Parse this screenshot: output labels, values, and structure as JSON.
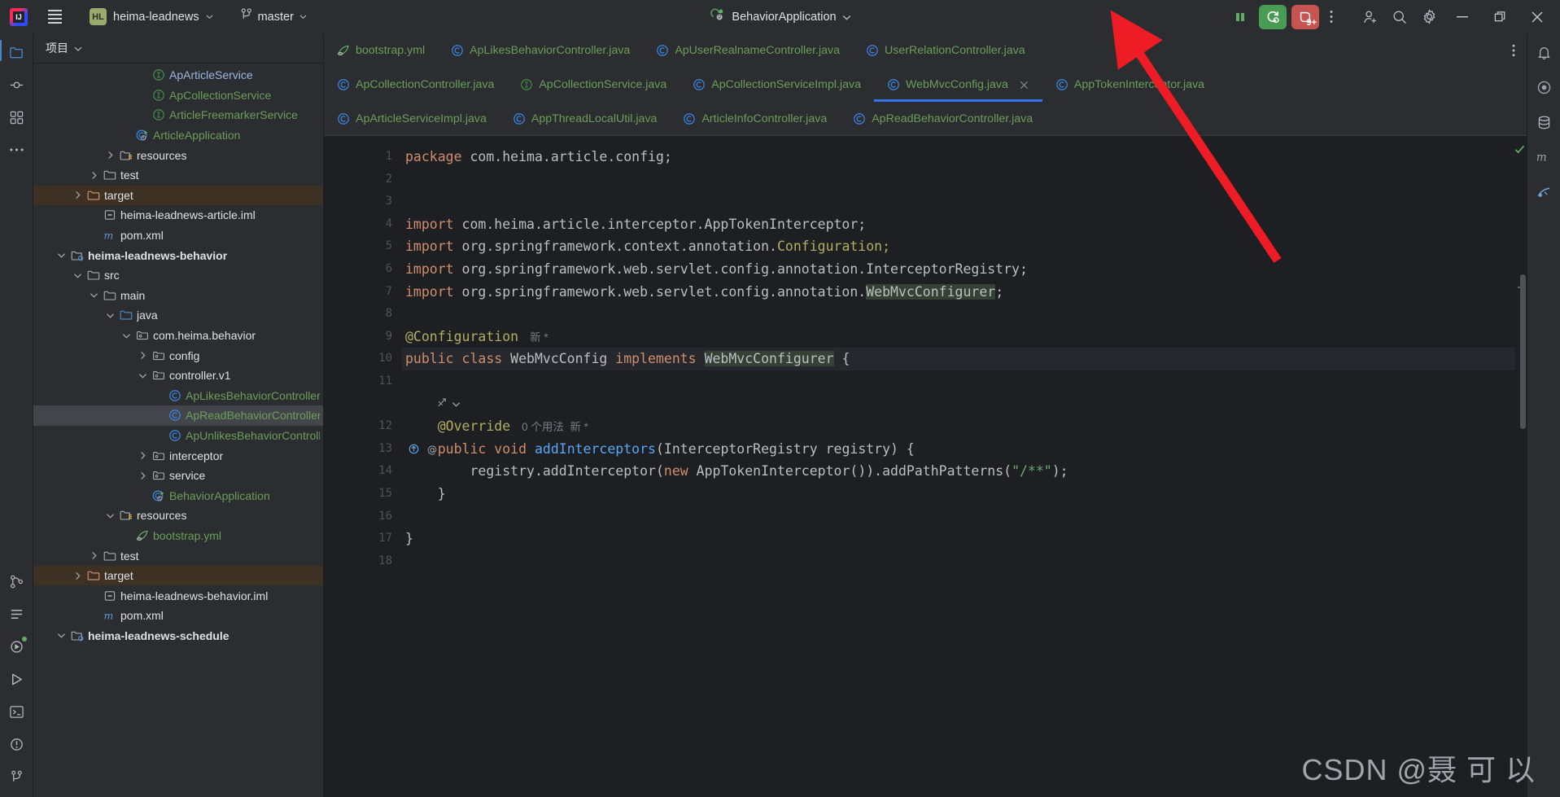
{
  "titlebar": {
    "logo_name": "intellij-idea-logo",
    "menu_label": "main-menu",
    "project_badge": "HL",
    "project_name": "heima-leadnews",
    "branch_name": "master",
    "run_config_name": "BehaviorApplication",
    "buttons": {
      "stop": "stop-icon",
      "rerun": "rerun-icon",
      "debug": "debug-icon",
      "debug_badge": "9+",
      "more": "more-options-icon",
      "share": "add-user-icon",
      "search": "search-icon",
      "settings": "settings-icon",
      "minimize": "minimize-icon",
      "maximize": "maximize-icon",
      "close": "close-icon"
    }
  },
  "activity_bar": {
    "items": [
      {
        "name": "project-tool-icon",
        "label": "Project",
        "active": true
      },
      {
        "name": "commit-tool-icon",
        "label": "Commit"
      },
      {
        "name": "structure-tool-icon",
        "label": "Structure"
      },
      {
        "name": "more-tool-icon",
        "label": "More"
      },
      {
        "name": "version-control-icon",
        "label": "Version Control"
      },
      {
        "name": "todo-icon",
        "label": "TODO"
      },
      {
        "name": "services-icon",
        "label": "Services"
      },
      {
        "name": "run-icon",
        "label": "Run"
      },
      {
        "name": "terminal-icon",
        "label": "Terminal"
      },
      {
        "name": "problems-icon",
        "label": "Problems"
      },
      {
        "name": "git-branch-icon",
        "label": "Git"
      }
    ]
  },
  "right_bar": {
    "items": [
      {
        "name": "notifications-icon",
        "label": "Notifications"
      },
      {
        "name": "ai-assistant-icon",
        "label": "AI Assistant"
      },
      {
        "name": "database-icon",
        "label": "Database"
      },
      {
        "name": "maven-icon",
        "label": "Maven"
      },
      {
        "name": "gradle-icon",
        "label": "Gradle"
      }
    ]
  },
  "project_panel": {
    "title": "项目",
    "tree": [
      {
        "indent": 6,
        "arrow": "none",
        "icon": "interface-icon",
        "label": "ApArticleService",
        "color": "blue"
      },
      {
        "indent": 6,
        "arrow": "none",
        "icon": "interface-icon",
        "label": "ApCollectionService",
        "color": "green"
      },
      {
        "indent": 6,
        "arrow": "none",
        "icon": "interface-icon",
        "label": "ArticleFreemarkerService",
        "color": "green"
      },
      {
        "indent": 5,
        "arrow": "none",
        "icon": "spring-class-icon",
        "label": "ArticleApplication",
        "color": "green"
      },
      {
        "indent": 4,
        "arrow": "right",
        "icon": "resources-folder-icon",
        "label": "resources",
        "color": "white"
      },
      {
        "indent": 3,
        "arrow": "right",
        "icon": "folder-icon",
        "label": "test",
        "color": "white"
      },
      {
        "indent": 2,
        "arrow": "right",
        "icon": "target-folder-icon",
        "label": "target",
        "color": "white",
        "row_state": "orange"
      },
      {
        "indent": 3,
        "arrow": "none",
        "icon": "iml-file-icon",
        "label": "heima-leadnews-article.iml",
        "color": "white"
      },
      {
        "indent": 3,
        "arrow": "none",
        "icon": "maven-pom-icon",
        "label": "pom.xml",
        "color": "white"
      },
      {
        "indent": 1,
        "arrow": "down",
        "icon": "module-icon",
        "label": "heima-leadnews-behavior",
        "color": "white",
        "bold": true
      },
      {
        "indent": 2,
        "arrow": "down",
        "icon": "folder-icon",
        "label": "src",
        "color": "white"
      },
      {
        "indent": 3,
        "arrow": "down",
        "icon": "folder-icon",
        "label": "main",
        "color": "white"
      },
      {
        "indent": 4,
        "arrow": "down",
        "icon": "source-folder-icon",
        "label": "java",
        "color": "white"
      },
      {
        "indent": 5,
        "arrow": "down",
        "icon": "package-icon",
        "label": "com.heima.behavior",
        "color": "white"
      },
      {
        "indent": 6,
        "arrow": "right",
        "icon": "package-icon",
        "label": "config",
        "color": "white"
      },
      {
        "indent": 6,
        "arrow": "down",
        "icon": "package-icon",
        "label": "controller.v1",
        "color": "white"
      },
      {
        "indent": 7,
        "arrow": "none",
        "icon": "class-icon",
        "label": "ApLikesBehaviorController",
        "color": "green"
      },
      {
        "indent": 7,
        "arrow": "none",
        "icon": "class-icon",
        "label": "ApReadBehaviorController",
        "color": "green",
        "row_state": "selected"
      },
      {
        "indent": 7,
        "arrow": "none",
        "icon": "class-icon",
        "label": "ApUnlikesBehaviorController",
        "color": "green"
      },
      {
        "indent": 6,
        "arrow": "right",
        "icon": "package-icon",
        "label": "interceptor",
        "color": "white"
      },
      {
        "indent": 6,
        "arrow": "right",
        "icon": "package-icon",
        "label": "service",
        "color": "white"
      },
      {
        "indent": 6,
        "arrow": "none",
        "icon": "spring-class-icon",
        "label": "BehaviorApplication",
        "color": "green"
      },
      {
        "indent": 4,
        "arrow": "down",
        "icon": "resources-folder-icon",
        "label": "resources",
        "color": "white"
      },
      {
        "indent": 5,
        "arrow": "none",
        "icon": "yaml-icon",
        "label": "bootstrap.yml",
        "color": "green"
      },
      {
        "indent": 3,
        "arrow": "right",
        "icon": "folder-icon",
        "label": "test",
        "color": "white"
      },
      {
        "indent": 2,
        "arrow": "right",
        "icon": "target-folder-icon",
        "label": "target",
        "color": "white",
        "row_state": "orange"
      },
      {
        "indent": 3,
        "arrow": "none",
        "icon": "iml-file-icon",
        "label": "heima-leadnews-behavior.iml",
        "color": "white"
      },
      {
        "indent": 3,
        "arrow": "none",
        "icon": "maven-pom-icon",
        "label": "pom.xml",
        "color": "white"
      },
      {
        "indent": 1,
        "arrow": "down",
        "icon": "module-icon",
        "label": "heima-leadnews-schedule",
        "color": "white",
        "bold": true
      }
    ]
  },
  "editor": {
    "tab_rows": [
      [
        {
          "label": "bootstrap.yml",
          "icon": "yaml-icon"
        },
        {
          "label": "ApLikesBehaviorController.java",
          "icon": "class-icon"
        },
        {
          "label": "ApUserRealnameController.java",
          "icon": "class-icon"
        },
        {
          "label": "UserRelationController.java",
          "icon": "class-icon"
        }
      ],
      [
        {
          "label": "ApCollectionController.java",
          "icon": "class-icon"
        },
        {
          "label": "ApCollectionService.java",
          "icon": "interface-icon"
        },
        {
          "label": "ApCollectionServiceImpl.java",
          "icon": "class-icon"
        },
        {
          "label": "WebMvcConfig.java",
          "icon": "class-icon",
          "active": true,
          "closable": true
        },
        {
          "label": "AppTokenInterceptor.java",
          "icon": "class-icon"
        }
      ],
      [
        {
          "label": "ApArticleServiceImpl.java",
          "icon": "class-icon"
        },
        {
          "label": "AppThreadLocalUtil.java",
          "icon": "class-icon"
        },
        {
          "label": "ArticleInfoController.java",
          "icon": "class-icon"
        },
        {
          "label": "ApReadBehaviorController.java",
          "icon": "class-icon"
        }
      ]
    ],
    "tab_overflow_icon": "more-tabs-icon",
    "line_numbers": [
      "1",
      "2",
      "3",
      "4",
      "5",
      "6",
      "7",
      "8",
      "9",
      "10",
      "11",
      "12",
      "13",
      "14",
      "15",
      "16",
      "17",
      "18"
    ],
    "code_lines": [
      {
        "n": 1,
        "tokens": [
          {
            "t": "package ",
            "c": "kw"
          },
          {
            "t": "com.heima.article.config;",
            "c": "ident"
          }
        ]
      },
      {
        "n": 2,
        "tokens": []
      },
      {
        "n": 3,
        "tokens": []
      },
      {
        "n": 4,
        "tokens": [
          {
            "t": "import ",
            "c": "kw"
          },
          {
            "t": "com.heima.article.interceptor.AppTokenInterceptor;",
            "c": "ident"
          }
        ]
      },
      {
        "n": 5,
        "tokens": [
          {
            "t": "import ",
            "c": "kw"
          },
          {
            "t": "org.springframework.context.annotation.",
            "c": "ident"
          },
          {
            "t": "Configuration;",
            "c": "ann"
          }
        ]
      },
      {
        "n": 6,
        "tokens": [
          {
            "t": "import ",
            "c": "kw"
          },
          {
            "t": "org.springframework.web.servlet.config.annotation.InterceptorRegistry;",
            "c": "ident"
          }
        ]
      },
      {
        "n": 7,
        "tokens": [
          {
            "t": "import ",
            "c": "kw"
          },
          {
            "t": "org.springframework.web.servlet.config.annotation.",
            "c": "ident"
          },
          {
            "t": "WebMvcConfigurer",
            "c": "hlref"
          },
          {
            "t": ";",
            "c": "ident"
          }
        ]
      },
      {
        "n": 8,
        "tokens": []
      },
      {
        "n": 9,
        "tokens": [
          {
            "t": "@Configuration",
            "c": "ann"
          }
        ],
        "hint": "新 *",
        "bulb": true
      },
      {
        "n": 10,
        "tokens": [
          {
            "t": "public class ",
            "c": "kw"
          },
          {
            "t": "WebMvcConfig ",
            "c": "ident"
          },
          {
            "t": "implements ",
            "c": "kw"
          },
          {
            "t": "WebMvcConfigurer",
            "c": "hlref"
          },
          {
            "t": " {",
            "c": "ident"
          }
        ],
        "highlight": true,
        "gutter_icon": "bean-icon"
      },
      {
        "n": 11,
        "tokens": []
      },
      {
        "n": 12,
        "tokens": [
          {
            "t": "    @Override",
            "c": "ann"
          }
        ],
        "hint": "0 个用法  新 *",
        "inlay_above": "override-inlay-icon"
      },
      {
        "n": 13,
        "tokens": [
          {
            "t": "    public void ",
            "c": "kw"
          },
          {
            "t": "addInterceptors",
            "c": "meth"
          },
          {
            "t": "(InterceptorRegistry registry) {",
            "c": "ident"
          }
        ],
        "gutter_icon": "override-method-icon",
        "gutter_icon2": "annotation-icon"
      },
      {
        "n": 14,
        "tokens": [
          {
            "t": "        registry.addInterceptor(",
            "c": "ident"
          },
          {
            "t": "new ",
            "c": "kw"
          },
          {
            "t": "AppTokenInterceptor()).addPathPatterns(",
            "c": "ident"
          },
          {
            "t": "\"/**\"",
            "c": "str"
          },
          {
            "t": ");",
            "c": "ident"
          }
        ]
      },
      {
        "n": 15,
        "tokens": [
          {
            "t": "    }",
            "c": "ident"
          }
        ]
      },
      {
        "n": 16,
        "tokens": []
      },
      {
        "n": 17,
        "tokens": [
          {
            "t": "}",
            "c": "ident"
          }
        ]
      },
      {
        "n": 18,
        "tokens": []
      }
    ],
    "inspection_status": "no-errors-check-icon"
  },
  "watermark": "CSDN @聂 可 以",
  "annotation": {
    "arrow_color": "#ee1c25",
    "name": "red-arrow-annotation"
  },
  "colors": {
    "accent_blue": "#3574f0",
    "run_green": "#499c54",
    "debug_red": "#c75450",
    "bg": "#2b2d30",
    "editor_bg": "#1e1f22"
  }
}
